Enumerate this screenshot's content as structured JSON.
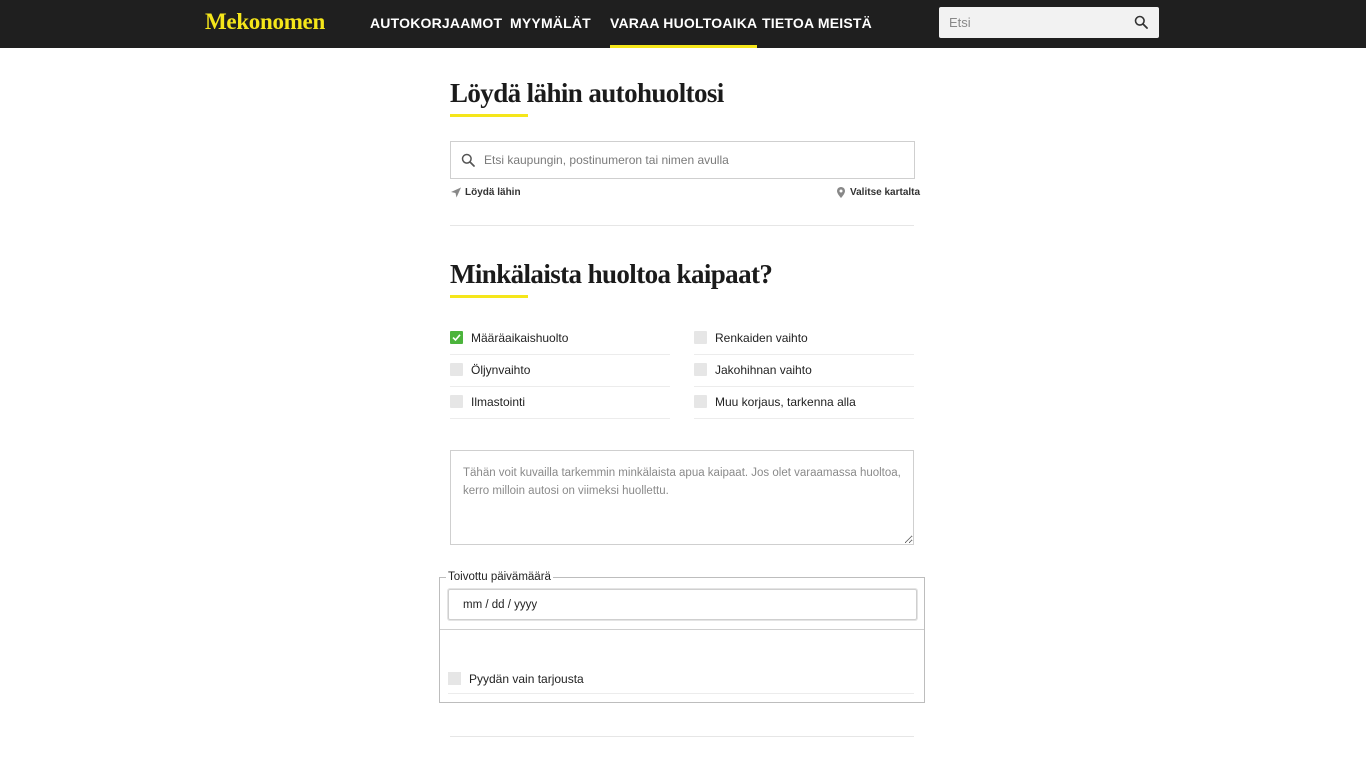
{
  "brand": {
    "name": "Mekonomen",
    "accent": "#f5e61a",
    "header_bg": "#1f1f1f"
  },
  "nav": {
    "items": [
      {
        "label": "AUTOKORJAAMOT",
        "active": false
      },
      {
        "label": "MYYMÄLÄT",
        "active": false
      },
      {
        "label": "VARAA HUOLTOAIKA",
        "active": true
      },
      {
        "label": "TIETOA MEISTÄ",
        "active": false
      }
    ],
    "search_placeholder": "Etsi",
    "search_icon": "search-icon"
  },
  "find_section": {
    "title": "Löydä lähin autohuoltosi",
    "search_placeholder": "Etsi kaupungin, postinumeron tai nimen avulla",
    "find_nearest_label": "Löydä lähin",
    "find_nearest_icon": "location-arrow-icon",
    "select_map_label": "Valitse kartalta",
    "select_map_icon": "map-pin-icon"
  },
  "service_section": {
    "title": "Minkälaista huoltoa kaipaat?",
    "options": [
      {
        "label": "Määräaikaishuolto",
        "checked": true
      },
      {
        "label": "Renkaiden vaihto",
        "checked": false
      },
      {
        "label": "Öljynvaihto",
        "checked": false
      },
      {
        "label": "Jakohihnan vaihto",
        "checked": false
      },
      {
        "label": "Ilmastointi",
        "checked": false
      },
      {
        "label": "Muu korjaus, tarkenna alla",
        "checked": false
      }
    ],
    "check_color": "#4cb43c",
    "description_placeholder": "Tähän voit kuvailla tarkemmin minkälaista apua kaipaat. Jos olet varaamassa huoltoa, kerro milloin autosi on viimeksi huollettu."
  },
  "date_section": {
    "legend": "Toivottu päivämäärä",
    "date_value": "mm / dd / yyyy",
    "quote_only_label": "Pyydän vain tarjousta",
    "quote_only_checked": false
  }
}
